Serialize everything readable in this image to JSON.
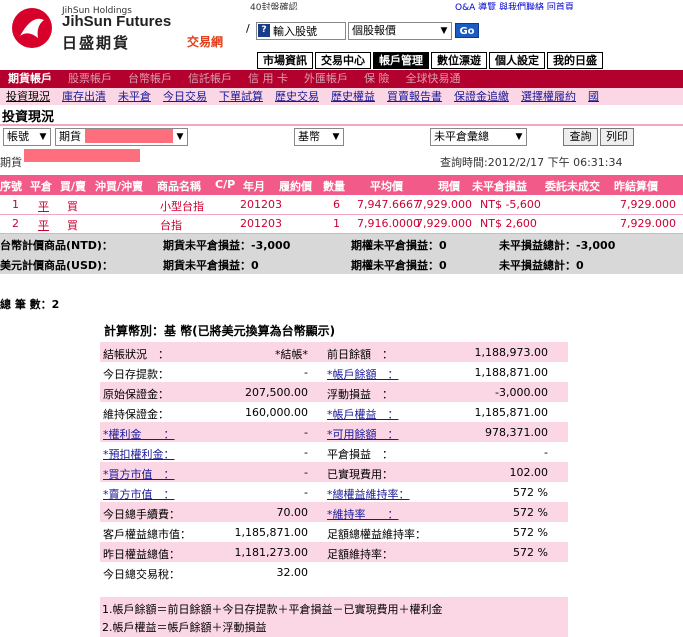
{
  "brand": {
    "small": "JihSun Holdings",
    "english": "JihSun Futures",
    "chinese": "日盛期貨",
    "trade_net": "交易網",
    "accent": "#e2401a"
  },
  "ticker": "40封盤確認",
  "top_links": "Q&A  導覽  與我們聯絡  回首頁",
  "search": {
    "stock_value": "輸入股號",
    "type_value": "個股報價",
    "go_label": "Go"
  },
  "main_nav": [
    "市場資訊",
    "交易中心",
    "帳戶管理",
    "數位漂遊",
    "個人設定",
    "我的日盛"
  ],
  "main_nav_active": 2,
  "account_tabs": [
    "期貨帳戶",
    "股票帳戶",
    "台幣帳戶",
    "信託帳戶",
    "信 用 卡",
    "外匯帳戶",
    "保    險",
    "全球快易通"
  ],
  "sub_tabs": [
    "投資現況",
    "庫存出清",
    "未平倉",
    "今日交易",
    "下單試算",
    "歷史交易",
    "歷史權益",
    "買賣報告書",
    "保證金追繳",
    "選擇權履約",
    "國"
  ],
  "page_title": "投資現況",
  "filters": {
    "account_type": "帳號",
    "futures_account": "期貨",
    "currency": "基幣",
    "unrealized": "未平倉彙總",
    "query_button": "查詢",
    "print_button": "列印",
    "account_label": "期貨",
    "query_time": "查詢時間:2012/2/17 下午 06:31:34"
  },
  "positions": {
    "headers": [
      "序號",
      "平倉",
      "買/賣",
      "沖買/沖賣",
      "商品名稱",
      "C/P",
      "年月",
      "履約價",
      "數量",
      "平均價",
      "現價",
      "未平倉損益",
      "委託未成交",
      "昨結算價"
    ],
    "rows": [
      {
        "no": "1",
        "close": "平",
        "side": "買",
        "product": "小型台指",
        "ym": "201203",
        "qty": "6",
        "avg": "7,947.6667",
        "price": "7,929.000",
        "pnl": "NT$ -5,600",
        "settle": "7,929.000"
      },
      {
        "no": "2",
        "close": "平",
        "side": "買",
        "product": "台指",
        "ym": "201203",
        "qty": "1",
        "avg": "7,916.0000",
        "price": "7,929.000",
        "pnl": "NT$ 2,600",
        "settle": "7,929.000"
      }
    ],
    "summary": {
      "ntd_label": "台幣計價商品(NTD)：",
      "ntd_fut": "期貨未平倉損益：-3,000",
      "ntd_opt": "期權未平倉損益：0",
      "ntd_total": "未平損益總計：-3,000",
      "usd_label": "美元計價商品(USD)：",
      "usd_fut": "期貨未平倉損益：0",
      "usd_opt": "期權未平倉損益：0",
      "usd_total": "未平損益總計：0"
    }
  },
  "total_count": "總 筆 數：2",
  "detail": {
    "currency_title": "計算幣別：基 幣(已將美元換算為台幣顯示)",
    "rows": [
      {
        "l1": "結帳狀況　：",
        "v1": "*結帳*",
        "l2": "前日餘額　：",
        "v2": "1,188,973.00"
      },
      {
        "l1": "今日存提款：",
        "v1": "-",
        "l2": "*帳戶餘額　：",
        "v2": "1,188,871.00"
      },
      {
        "l1": "原始保證金：",
        "v1": "207,500.00",
        "l2": "浮動損益　：",
        "v2": "-3,000.00"
      },
      {
        "l1": "維持保證金：",
        "v1": "160,000.00",
        "l2": "*帳戶權益　：",
        "v2": "1,185,871.00"
      },
      {
        "l1": "*權利金　　：",
        "v1": "-",
        "l2": "*可用餘額　：",
        "v2": "978,371.00"
      },
      {
        "l1": "*預扣權利金：",
        "v1": "-",
        "l2": "平倉損益　：",
        "v2": "-"
      },
      {
        "l1": "*買方市值　：",
        "v1": "-",
        "l2": "已實現費用：",
        "v2": "102.00"
      },
      {
        "l1": "*賣方市值　：",
        "v1": "-",
        "l2": "*總權益維持率：",
        "v2": "572 %"
      },
      {
        "l1": "今日總手續費：",
        "v1": "70.00",
        "l2": "*維持率　　：",
        "v2": "572 %"
      },
      {
        "l1": "客戶權益總市值：",
        "v1": "1,185,871.00",
        "l2": "足額總權益維持率：",
        "v2": "572 %"
      },
      {
        "l1": "昨日權益總值：",
        "v1": "1,181,273.00",
        "l2": "足額維持率：",
        "v2": "572 %"
      },
      {
        "l1": "今日總交易稅：",
        "v1": "32.00",
        "l2": "",
        "v2": ""
      }
    ],
    "notes": [
      "1.帳戶餘額＝前日餘額＋今日存提款＋平倉損益－已實現費用＋權利金",
      "2.帳戶權益＝帳戶餘額＋浮動損益"
    ]
  },
  "colors": {
    "red_bar": "#b3002d",
    "pink_header": "#f25a8a",
    "light_pink": "#fbd6e4",
    "loss_red": "#cc0033"
  }
}
